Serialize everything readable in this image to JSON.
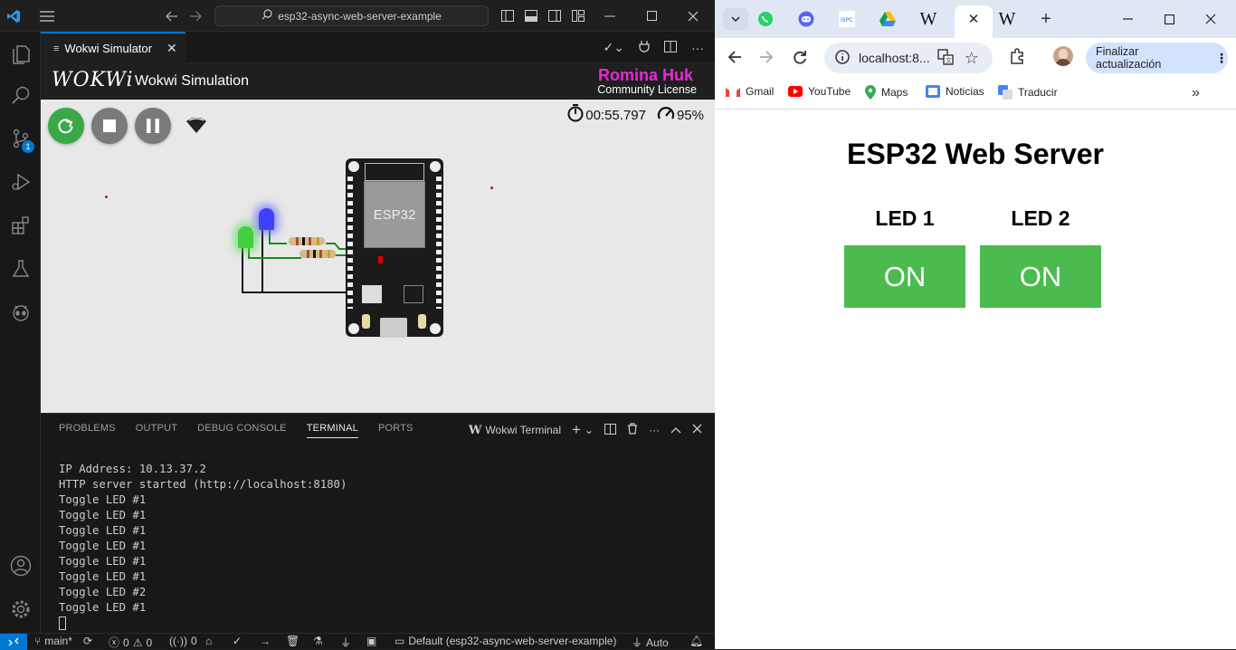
{
  "vscode": {
    "search_text": "esp32-async-web-server-example",
    "scm_badge": "1",
    "tab_label": "Wokwi Simulator",
    "wokwi": {
      "logo": "WOKWi",
      "title": "Wokwi Simulation",
      "user": "Romina Huk",
      "license": "Community License",
      "timer": "00:55.797",
      "speed": "95%",
      "chip_label": "ESP32"
    },
    "panel": {
      "tabs": [
        "PROBLEMS",
        "OUTPUT",
        "DEBUG CONSOLE",
        "TERMINAL",
        "PORTS"
      ],
      "active_tab": "TERMINAL",
      "terminal_name": "Wokwi Terminal",
      "lines": [
        "IP Address: 10.13.37.2",
        "HTTP server started (http://localhost:8180)",
        "Toggle LED #1",
        "Toggle LED #1",
        "Toggle LED #1",
        "Toggle LED #1",
        "Toggle LED #1",
        "Toggle LED #1",
        "Toggle LED #2",
        "Toggle LED #1"
      ]
    },
    "status": {
      "branch": "main*",
      "errors": "0",
      "warnings": "0",
      "ports": "0",
      "config": "Default (esp32-async-web-server-example)",
      "auto": "Auto"
    }
  },
  "browser": {
    "url": "localhost:8...",
    "update_label": "Finalizar actualización",
    "bookmarks": [
      "Gmail",
      "YouTube",
      "Maps",
      "Noticias",
      "Traducir"
    ],
    "page": {
      "title": "ESP32 Web Server",
      "led1_label": "LED 1",
      "led2_label": "LED 2",
      "led1_button": "ON",
      "led2_button": "ON"
    }
  },
  "colors": {
    "accent": "#0078d4",
    "wokwi_user": "#e829d6",
    "button_green": "#4cbb4f"
  }
}
